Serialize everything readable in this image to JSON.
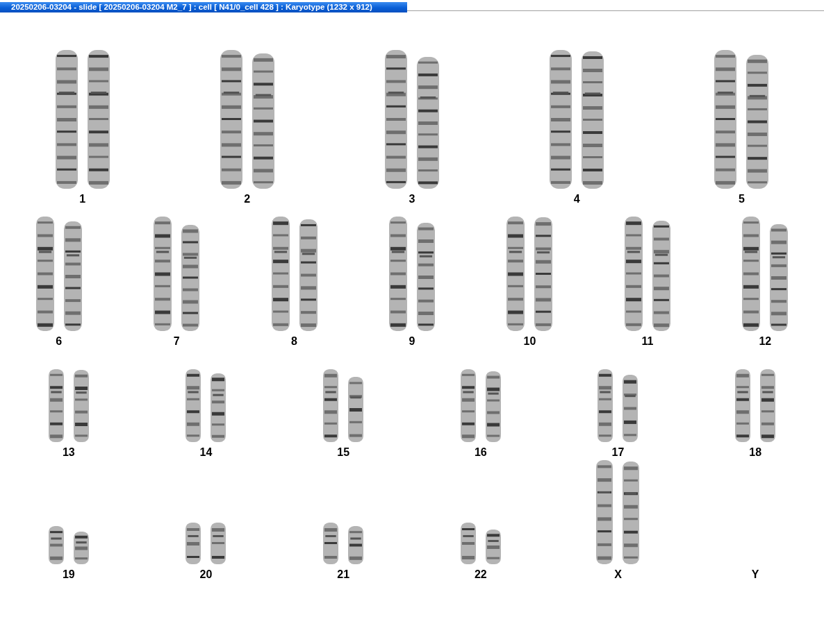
{
  "window": {
    "title": "20250206-03204 - slide [ 20250206-03204 M2_7 ] : cell [ N41/0_cell 428 ] : Karyotype  (1232 x 912)"
  },
  "karyotype": {
    "rows": [
      {
        "chromosomes": [
          {
            "label": "1",
            "kind": "pair"
          },
          {
            "label": "2",
            "kind": "pair"
          },
          {
            "label": "3",
            "kind": "pair"
          },
          {
            "label": "4",
            "kind": "pair"
          },
          {
            "label": "5",
            "kind": "pair"
          }
        ]
      },
      {
        "chromosomes": [
          {
            "label": "6",
            "kind": "pair"
          },
          {
            "label": "7",
            "kind": "pair"
          },
          {
            "label": "8",
            "kind": "pair"
          },
          {
            "label": "9",
            "kind": "pair"
          },
          {
            "label": "10",
            "kind": "pair"
          },
          {
            "label": "11",
            "kind": "pair"
          },
          {
            "label": "12",
            "kind": "pair"
          }
        ]
      },
      {
        "chromosomes": [
          {
            "label": "13",
            "kind": "pair"
          },
          {
            "label": "14",
            "kind": "pair"
          },
          {
            "label": "15",
            "kind": "pair"
          },
          {
            "label": "16",
            "kind": "pair"
          },
          {
            "label": "17",
            "kind": "pair"
          },
          {
            "label": "18",
            "kind": "pair"
          }
        ]
      },
      {
        "chromosomes": [
          {
            "label": "19",
            "kind": "pair"
          },
          {
            "label": "20",
            "kind": "pair"
          },
          {
            "label": "21",
            "kind": "pair"
          },
          {
            "label": "22",
            "kind": "pair"
          },
          {
            "label": "X",
            "kind": "pair"
          },
          {
            "label": "Y",
            "kind": "empty"
          }
        ]
      }
    ]
  }
}
